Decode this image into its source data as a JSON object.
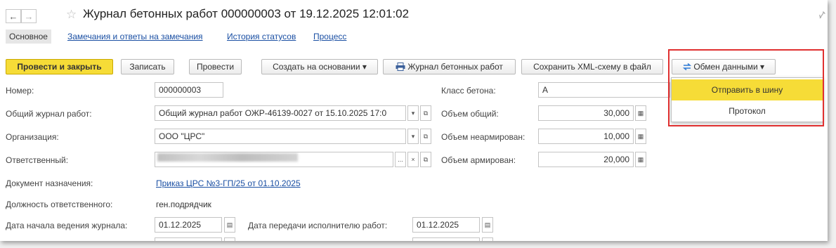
{
  "header": {
    "title": "Журнал бетонных работ 000000003 от 19.12.2025 12:01:02",
    "back_glyph": "←",
    "forward_glyph": "→",
    "star_glyph": "☆"
  },
  "tabs": [
    {
      "label": "Основное",
      "active": true
    },
    {
      "label": "Замечания и ответы на замечания"
    },
    {
      "label": "История статусов"
    },
    {
      "label": "Процесс"
    }
  ],
  "toolbar": {
    "post_close": "Провести и закрыть",
    "save": "Записать",
    "post": "Провести",
    "create_based": "Создать на основании",
    "print_journal": "Журнал бетонных работ",
    "save_xml": "Сохранить XML-схему в файл",
    "exchange": "Обмен данными",
    "dropdown_arrow": "▾"
  },
  "exchange_menu": {
    "items": [
      "Отправить в шину",
      "Протокол"
    ],
    "highlighted_index": 0
  },
  "form": {
    "number_label": "Номер:",
    "number_value": "000000003",
    "general_journal_label": "Общий журнал работ:",
    "general_journal_value": "Общий журнал работ ОЖР-46139-0027 от 15.10.2025 17:0",
    "org_label": "Организация:",
    "org_value": "ООО \"ЦРС\"",
    "responsible_label": "Ответственный:",
    "doc_label": "Документ назначения:",
    "doc_link": "Приказ ЦРС №3-ГП/25 от 01.10.2025",
    "position_label": "Должность ответственного:",
    "position_value": "ген.подрядчик",
    "start_date_label": "Дата начала ведения журнала:",
    "start_date_value": "01.12.2025",
    "transfer_date_label": "Дата передачи исполнителю работ:",
    "transfer_date_value": "01.12.2025",
    "concrete_class_label": "Класс бетона:",
    "concrete_class_value": "А",
    "volume_total_label": "Объем общий:",
    "volume_total_value": "30,000",
    "volume_nonreinf_label": "Объем неармирован:",
    "volume_nonreinf_value": "10,000",
    "volume_reinf_label": "Объем армирован:",
    "volume_reinf_value": "20,000",
    "ellipsis": "...",
    "clear": "×",
    "open": "⧉",
    "dropdown": "▾"
  }
}
